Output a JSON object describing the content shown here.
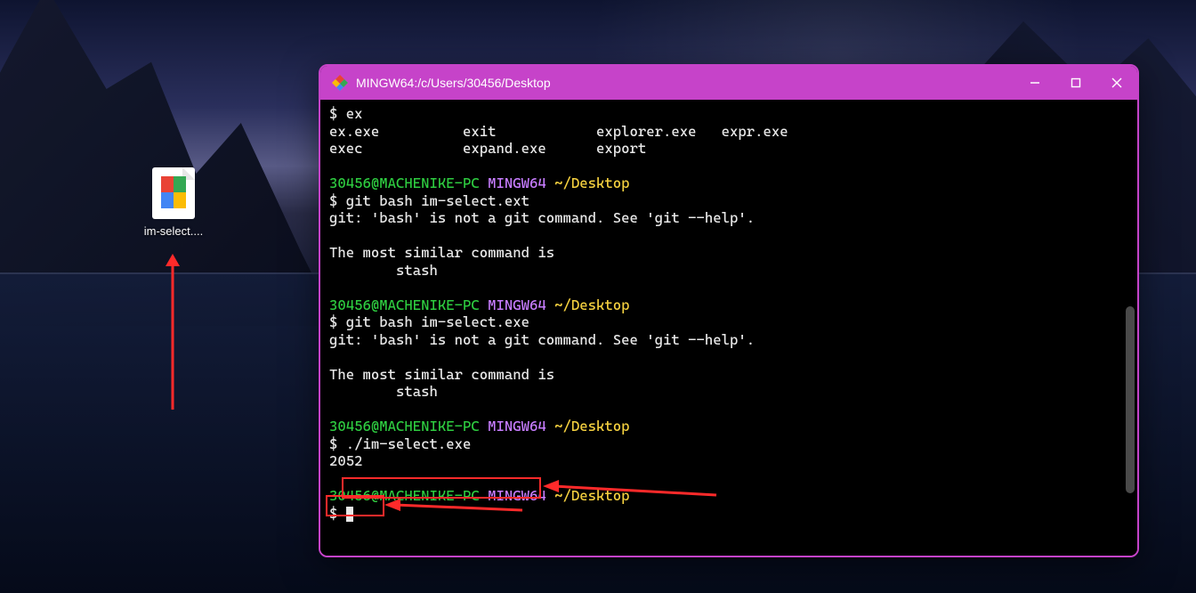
{
  "desktop_icon": {
    "label": "im-select...."
  },
  "window": {
    "title": "MINGW64:/c/Users/30456/Desktop"
  },
  "prompt": {
    "user_host": "30456@MACHENIKE-PC",
    "shell": "MINGW64",
    "path": "~/Desktop",
    "symbol": "$"
  },
  "blocks": {
    "ex_cmd": "$ ex",
    "ex_row1_c1": "ex.exe",
    "ex_row1_c2": "exit",
    "ex_row1_c3": "explorer.exe",
    "ex_row1_c4": "expr.exe",
    "ex_row2_c1": "exec",
    "ex_row2_c2": "expand.exe",
    "ex_row2_c3": "export",
    "cmd1": "$ git bash im-select.ext",
    "err1": "git: 'bash' is not a git command. See 'git --help'.",
    "sim1a": "The most similar command is",
    "sim1b": "        stash",
    "cmd2": "$ git bash im-select.exe",
    "err2": "git: 'bash' is not a git command. See 'git --help'.",
    "sim2a": "The most similar command is",
    "sim2b": "        stash",
    "cmd3_prefix": "$ ",
    "cmd3_body": "./im-select.exe",
    "out3": "2052",
    "final_prompt": "$ "
  }
}
